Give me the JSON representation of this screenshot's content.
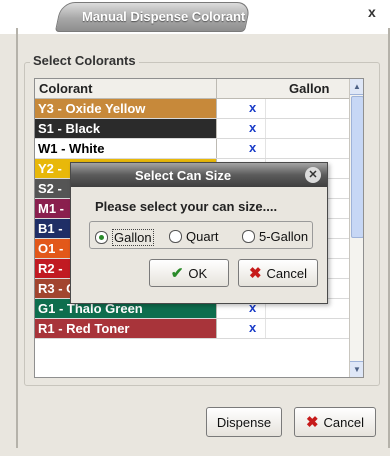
{
  "window": {
    "title": "Manual Dispense Colorant",
    "close_glyph": "x"
  },
  "group": {
    "legend": "Select Colorants"
  },
  "grid": {
    "headers": {
      "colorant": "Colorant",
      "gallon": "Gallon"
    },
    "rows": [
      {
        "label": "Y3 - Oxide Yellow",
        "mark": "x",
        "color": "#c7893a",
        "text_dark": false
      },
      {
        "label": "S1 - Black",
        "mark": "x",
        "color": "#2b2b2b",
        "text_dark": false
      },
      {
        "label": "W1 - White",
        "mark": "x",
        "color": "#ffffff",
        "text_dark": true
      },
      {
        "label": "Y2 -",
        "mark": "",
        "color": "#e8b80a",
        "text_dark": false
      },
      {
        "label": "S2 -",
        "mark": "",
        "color": "#555555",
        "text_dark": false
      },
      {
        "label": "M1 -",
        "mark": "",
        "color": "#8a1f4e",
        "text_dark": false
      },
      {
        "label": "B1 -",
        "mark": "",
        "color": "#1f2e66",
        "text_dark": false
      },
      {
        "label": "O1 -",
        "mark": "",
        "color": "#e2581a",
        "text_dark": false
      },
      {
        "label": "R2 -",
        "mark": "",
        "color": "#c11a22",
        "text_dark": false
      },
      {
        "label": "R3 - Oxide Red",
        "mark": "x",
        "color": "#a2452f",
        "text_dark": false
      },
      {
        "label": "G1 - Thalo Green",
        "mark": "x",
        "color": "#0e6e4e",
        "text_dark": false
      },
      {
        "label": "R1 - Red Toner",
        "mark": "x",
        "color": "#a8343a",
        "text_dark": false
      }
    ]
  },
  "buttons": {
    "dispense": "Dispense",
    "cancel": "Cancel"
  },
  "modal": {
    "title": "Select Can Size",
    "prompt": "Please select your can size....",
    "options": [
      {
        "label": "Gallon",
        "selected": true
      },
      {
        "label": "Quart",
        "selected": false
      },
      {
        "label": "5-Gallon",
        "selected": false
      }
    ],
    "ok": "OK",
    "cancel": "Cancel"
  }
}
